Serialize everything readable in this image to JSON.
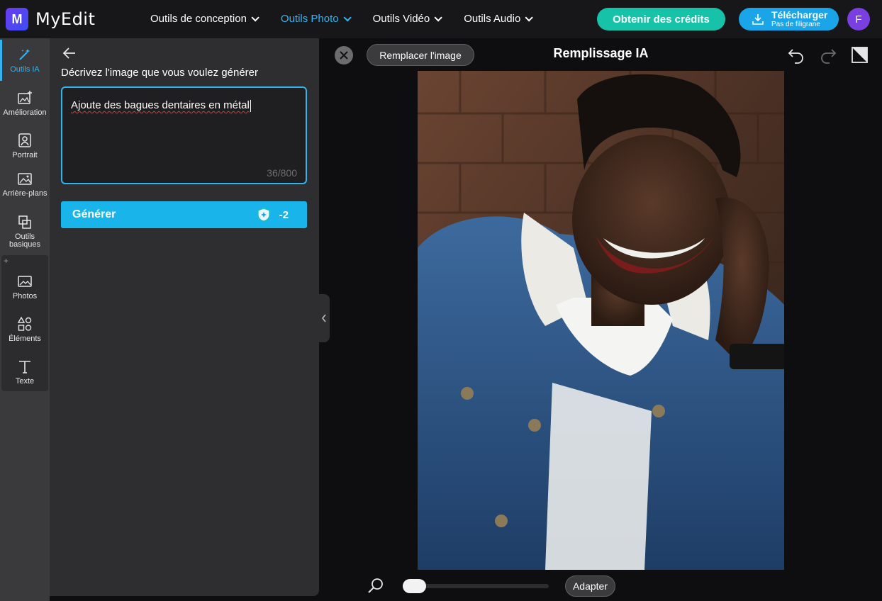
{
  "app": {
    "logo_text": "MyEdit",
    "logo_letter": "M"
  },
  "nav": {
    "items": [
      {
        "label": "Outils de conception",
        "active": false
      },
      {
        "label": "Outils Photo",
        "active": true
      },
      {
        "label": "Outils Vidéo",
        "active": false
      },
      {
        "label": "Outils Audio",
        "active": false
      }
    ]
  },
  "header": {
    "credits_label": "Obtenir des crédits",
    "download_label": "Télécharger",
    "download_sublabel": "Pas de filigrane",
    "avatar_initial": "F"
  },
  "sidebar": {
    "items": [
      {
        "label": "Outils IA",
        "icon": "magic-wand-icon",
        "active": true
      },
      {
        "label": "Amélioration",
        "icon": "image-enhance-icon"
      },
      {
        "label": "Portrait",
        "icon": "portrait-icon"
      },
      {
        "label": "Arrière-plans",
        "icon": "background-icon"
      },
      {
        "label": "Outils basiques",
        "icon": "crop-icon"
      },
      {
        "label": "Photos",
        "icon": "photo-icon"
      },
      {
        "label": "Éléments",
        "icon": "shapes-icon"
      },
      {
        "label": "Texte",
        "icon": "text-icon"
      }
    ],
    "group_plus": "+"
  },
  "panel": {
    "title": "Décrivez l'image que vous voulez générer",
    "prompt_value": "Ajoute des bagues dentaires en métal",
    "counter": "36/800",
    "generate_label": "Générer",
    "generate_cost": "-2"
  },
  "canvas": {
    "replace_label": "Remplacer l'image",
    "title": "Remplissage IA",
    "fit_label": "Adapter",
    "zoom_level": 0.1
  },
  "colors": {
    "accent": "#33b4f0",
    "credits": "#17c3a8",
    "download": "#1aa5e8",
    "avatar": "#7a3fe0"
  }
}
